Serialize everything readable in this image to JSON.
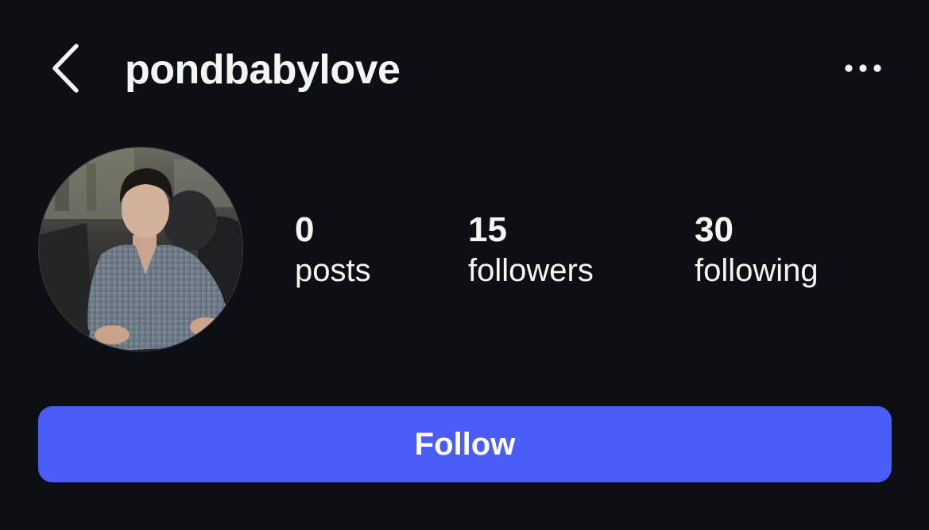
{
  "header": {
    "username": "pondbabylove",
    "back_icon": "chevron-left-icon",
    "more_icon": "more-horizontal-icon"
  },
  "profile": {
    "avatar_description_icon": "profile-photo",
    "stats": [
      {
        "count": "0",
        "label": "posts"
      },
      {
        "count": "15",
        "label": "followers"
      },
      {
        "count": "30",
        "label": "following"
      }
    ]
  },
  "actions": {
    "follow_label": "Follow"
  },
  "colors": {
    "background": "#0c1014",
    "text": "#f5f5f5",
    "follow_button": "#4a5df9"
  }
}
